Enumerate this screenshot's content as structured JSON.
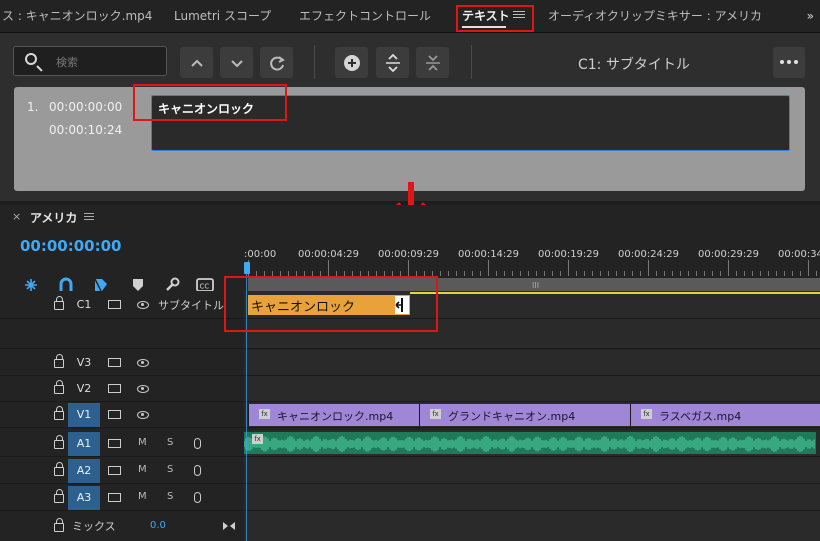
{
  "tabs": {
    "items": [
      {
        "label": "ス : キャニオンロック.mp4",
        "active": false
      },
      {
        "label": "Lumetri スコープ",
        "active": false
      },
      {
        "label": "エフェクトコントロール",
        "active": false
      },
      {
        "label": "テキスト",
        "active": true
      },
      {
        "label": "オーディオクリップミキサー : アメリカ",
        "active": false
      }
    ],
    "overflow": "»"
  },
  "text_panel": {
    "search_placeholder": "検索",
    "caption_track_label": "C1: サブタイトル",
    "caption": {
      "number": "1.",
      "in": "00:00:00:00",
      "out": "00:00:10:24",
      "text": "キャニオンロック"
    }
  },
  "timeline": {
    "sequence_name": "アメリカ",
    "close": "×",
    "timecode": "00:00:00:00",
    "ruler": [
      ":00:00",
      "00:00:04:29",
      "00:00:09:29",
      "00:00:14:29",
      "00:00:19:29",
      "00:00:24:29",
      "00:00:29:29",
      "00:00:34:"
    ],
    "caption_track": {
      "name": "C1",
      "label": "サブタイトル",
      "clip": "キャニオンロック"
    },
    "video_tracks": [
      {
        "name": "V3",
        "active": false
      },
      {
        "name": "V2",
        "active": false
      },
      {
        "name": "V1",
        "active": true
      }
    ],
    "video_clips": [
      "キャニオンロック.mp4",
      "グランドキャニオン.mp4",
      "ラスベガス.mp4"
    ],
    "audio_tracks": [
      {
        "name": "A1",
        "m": "M",
        "s": "S"
      },
      {
        "name": "A2",
        "m": "M",
        "s": "S"
      },
      {
        "name": "A3",
        "m": "M",
        "s": "S"
      }
    ],
    "mix": {
      "label": "ミックス",
      "value": "0.0"
    },
    "fx": "fx",
    "workbar_grip": "III"
  },
  "colors": {
    "accent": "#3fa9f5",
    "caption_clip": "#e9a13a",
    "video_clip": "#9f86d6",
    "audio_clip": "#1f7a5c",
    "highlight": "#e01515"
  }
}
